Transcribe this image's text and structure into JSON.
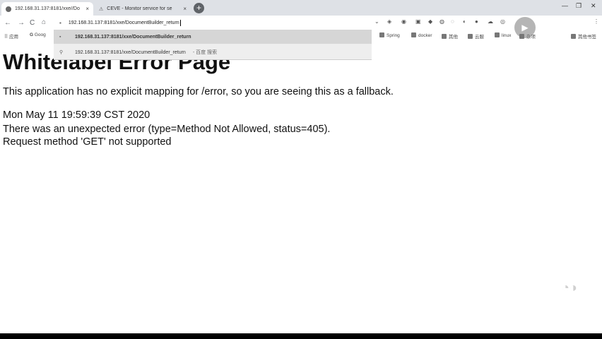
{
  "browser": {
    "tabs": [
      {
        "title": "192.168.31.137:8181/xxe//Do",
        "active": true
      },
      {
        "title": "CEVE - Monitor service for se",
        "active": false
      }
    ],
    "new_tab": "+",
    "close_glyph": "×",
    "win_minimize": "—",
    "win_restore": "❐",
    "win_close": "✕",
    "nav": {
      "back": "←",
      "forward": "→",
      "reload": "C",
      "home": "⌂"
    },
    "address_bar": {
      "value": "192.168.31.137:8181/xxe/DocumentBuilder_return"
    },
    "suggestions": [
      {
        "text": "192.168.31.137:8181/xxe/DocumentBuilder_return",
        "desc": "",
        "highlighted": true
      },
      {
        "text": "192.168.31.137:8181/xxe/DocumentBuilder_return",
        "desc": "- 百度 搜索",
        "highlighted": false
      }
    ],
    "bookmarks": {
      "apps": "应用",
      "google": "Goog",
      "items": [
        "Spring",
        "docker",
        "其他",
        "云服",
        "linux",
        "杂项",
        "其他书签"
      ]
    }
  },
  "page": {
    "heading": "Whitelabel Error Page",
    "fallback_msg": "This application has no explicit mapping for /error, so you are seeing this as a fallback.",
    "timestamp": "Mon May 11 19:59:39 CST 2020",
    "error_line": "There was an unexpected error (type=Method Not Allowed, status=405).",
    "request_line": "Request method 'GET' not supported"
  },
  "colors": {
    "tabbar": "#dee1e6",
    "highlight": "#d6d6d6",
    "text": "#111111"
  }
}
